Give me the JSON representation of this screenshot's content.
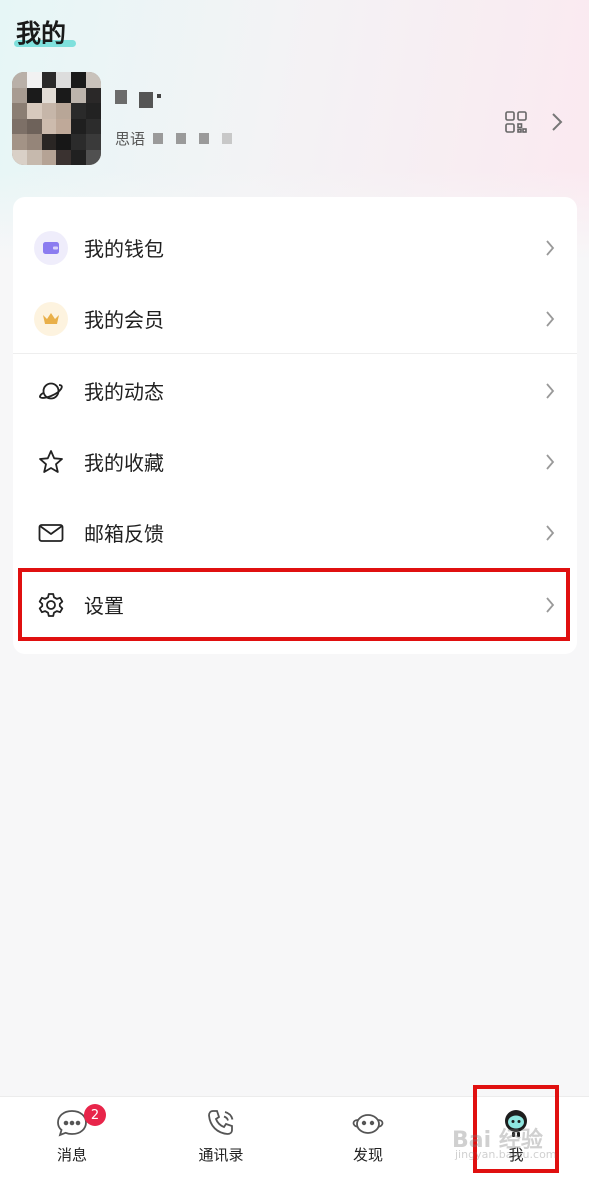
{
  "page": {
    "title": "我的"
  },
  "profile": {
    "id_prefix": "思语",
    "icons": {
      "qr": "qr-code-icon",
      "arrow": "chevron-right-icon"
    }
  },
  "menu": {
    "items": [
      {
        "label": "我的钱包",
        "icon": "wallet-icon",
        "icon_color": "#8b7cf0",
        "icon_bg": "#efedfb"
      },
      {
        "label": "我的会员",
        "icon": "crown-icon",
        "icon_color": "#e9b04a",
        "icon_bg": "#fdf3df"
      },
      {
        "label": "我的动态",
        "icon": "planet-icon"
      },
      {
        "label": "我的收藏",
        "icon": "star-icon"
      },
      {
        "label": "邮箱反馈",
        "icon": "mail-icon"
      },
      {
        "label": "设置",
        "icon": "gear-icon"
      }
    ]
  },
  "tabbar": {
    "tabs": [
      {
        "label": "消息",
        "icon": "message-bubble-icon",
        "badge": "2"
      },
      {
        "label": "通讯录",
        "icon": "phone-contact-icon"
      },
      {
        "label": "发现",
        "icon": "planet-face-icon"
      },
      {
        "label": "我",
        "icon": "robot-avatar-icon",
        "active": true
      }
    ]
  },
  "watermark": {
    "text": "Bai 经验",
    "sub": "jingyan.baidu.com"
  },
  "colors": {
    "highlight": "#e01010",
    "accent": "#7fe0dc",
    "badge": "#e8254a"
  }
}
